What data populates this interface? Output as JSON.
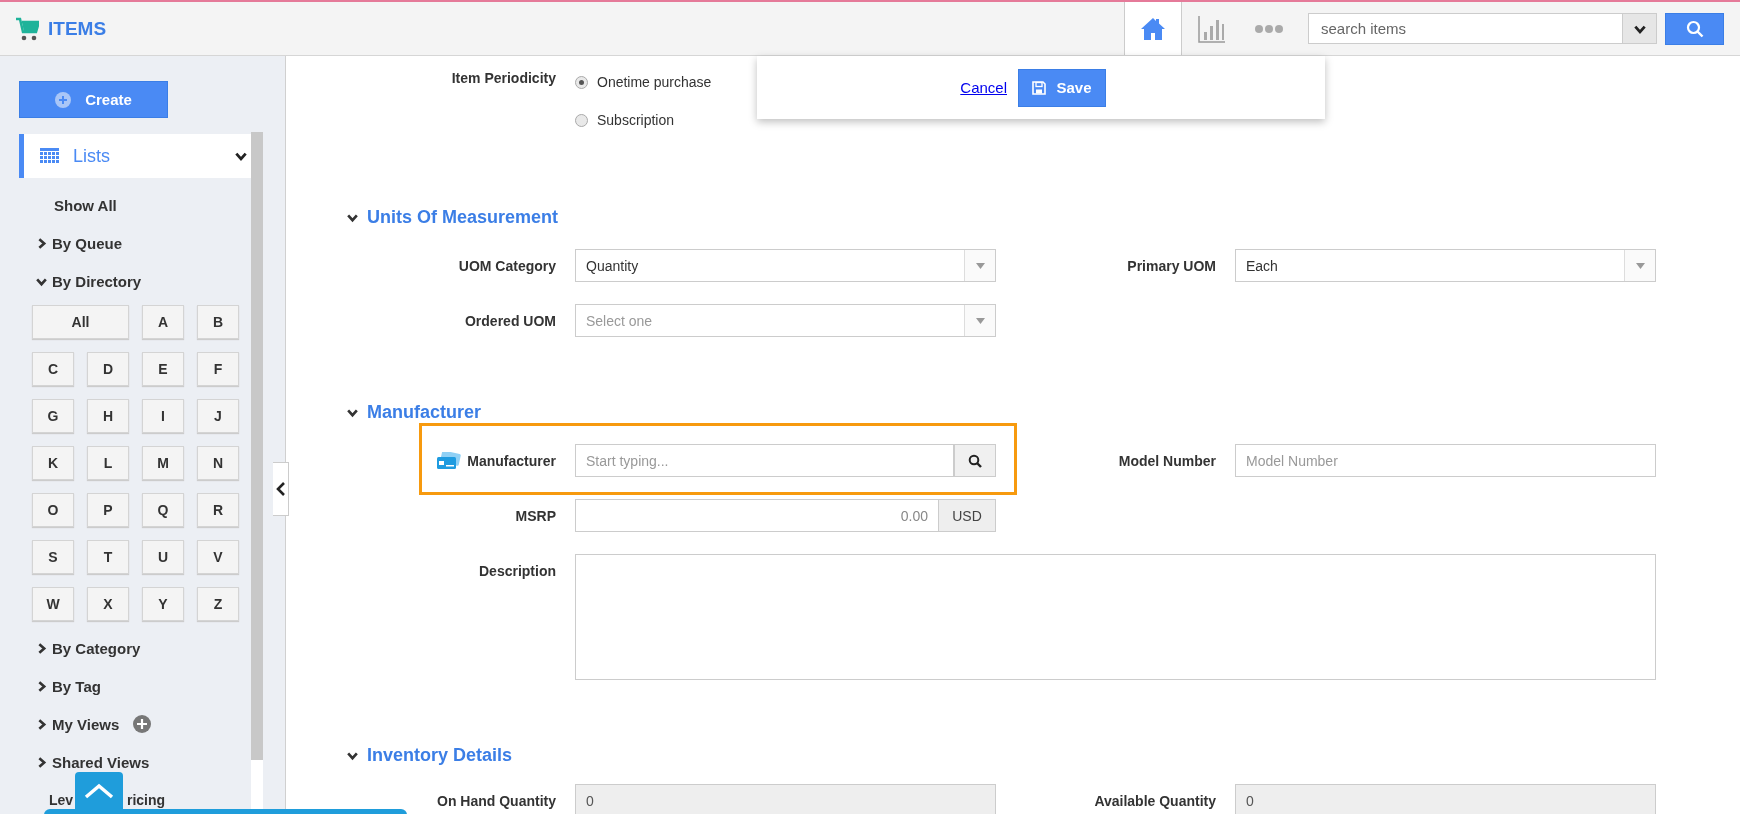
{
  "app": {
    "title": "ITEMS"
  },
  "toolbar": {
    "icons": [
      {
        "kind": "home",
        "selected": true
      },
      {
        "kind": "chart",
        "selected": false
      },
      {
        "kind": "more",
        "selected": false
      }
    ],
    "search": {
      "placeholder": "search items"
    }
  },
  "sidebar": {
    "create_label": "Create",
    "lists": {
      "label": "Lists",
      "expanded": true
    },
    "items": [
      {
        "label": "Show All",
        "kind": "plain"
      },
      {
        "label": "By Queue",
        "kind": "group",
        "expanded": false
      },
      {
        "label": "By Directory",
        "kind": "group",
        "expanded": true,
        "letters": [
          "All",
          "A",
          "B",
          "C",
          "D",
          "E",
          "F",
          "G",
          "H",
          "I",
          "J",
          "K",
          "L",
          "M",
          "N",
          "O",
          "P",
          "Q",
          "R",
          "S",
          "T",
          "U",
          "V",
          "W",
          "X",
          "Y",
          "Z"
        ]
      },
      {
        "label": "By Category",
        "kind": "group",
        "expanded": false
      },
      {
        "label": "By Tag",
        "kind": "group",
        "expanded": false
      },
      {
        "label": "My Views",
        "kind": "group",
        "expanded": false,
        "addable": true
      },
      {
        "label": "Shared Views",
        "kind": "group",
        "expanded": false
      },
      {
        "kind": "covered",
        "parts": [
          "Lev",
          "ricing"
        ]
      }
    ]
  },
  "form": {
    "periodicity": {
      "label": "Item Periodicity",
      "options": [
        {
          "label": "Onetime purchase",
          "selected": true
        },
        {
          "label": "Subscription",
          "selected": false
        }
      ]
    },
    "actions": {
      "cancel": "Cancel",
      "save": "Save"
    },
    "sections": [
      {
        "title": "Units Of Measurement",
        "expanded": true,
        "rows": [
          [
            {
              "label": "UOM Category",
              "kind": "select",
              "value": "Quantity"
            },
            {
              "label": "Primary UOM",
              "kind": "select",
              "value": "Each"
            }
          ],
          [
            {
              "label": "Ordered UOM",
              "kind": "select",
              "placeholder": "Select one"
            }
          ]
        ]
      },
      {
        "title": "Manufacturer",
        "expanded": true,
        "rows": [
          [
            {
              "label": "Manufacturer",
              "kind": "lookup",
              "placeholder": "Start typing...",
              "highlighted": true
            },
            {
              "label": "Model Number",
              "kind": "text",
              "placeholder": "Model Number"
            }
          ],
          [
            {
              "label": "MSRP",
              "kind": "currency",
              "placeholder": "0.00",
              "unit": "USD"
            }
          ],
          [
            {
              "label": "Description",
              "kind": "textarea"
            }
          ]
        ]
      },
      {
        "title": "Inventory Details",
        "expanded": true,
        "rows": [
          [
            {
              "label": "On Hand Quantity",
              "kind": "text",
              "value": "0",
              "disabled": true
            },
            {
              "label": "Available Quantity",
              "kind": "text",
              "value": "0",
              "disabled": true
            }
          ]
        ]
      }
    ]
  }
}
